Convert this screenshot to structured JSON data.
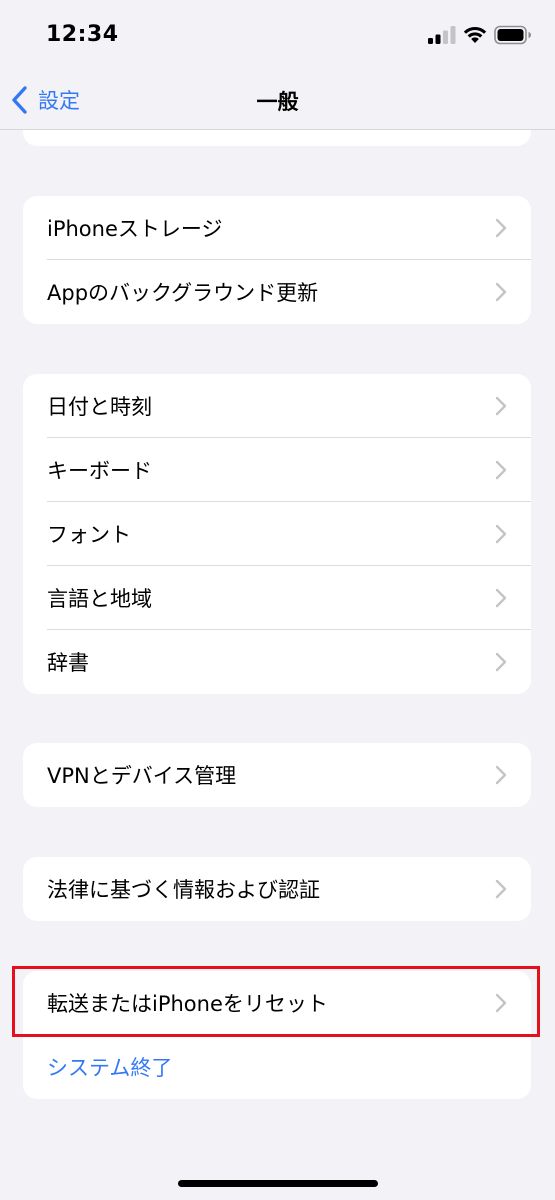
{
  "status": {
    "time": "12:34"
  },
  "nav": {
    "back_label": "設定",
    "title": "一般"
  },
  "groups": [
    {
      "items": [
        {
          "label": "iPhoneストレージ"
        },
        {
          "label": "Appのバックグラウンド更新"
        }
      ]
    },
    {
      "items": [
        {
          "label": "日付と時刻"
        },
        {
          "label": "キーボード"
        },
        {
          "label": "フォント"
        },
        {
          "label": "言語と地域"
        },
        {
          "label": "辞書"
        }
      ]
    },
    {
      "items": [
        {
          "label": "VPNとデバイス管理"
        }
      ]
    },
    {
      "items": [
        {
          "label": "法律に基づく情報および認証"
        }
      ]
    },
    {
      "items": [
        {
          "label": "転送またはiPhoneをリセット"
        },
        {
          "label": "システム終了"
        }
      ]
    }
  ],
  "colors": {
    "accent": "#3478f6",
    "highlight": "#e5101d",
    "background": "#f2f2f7"
  }
}
